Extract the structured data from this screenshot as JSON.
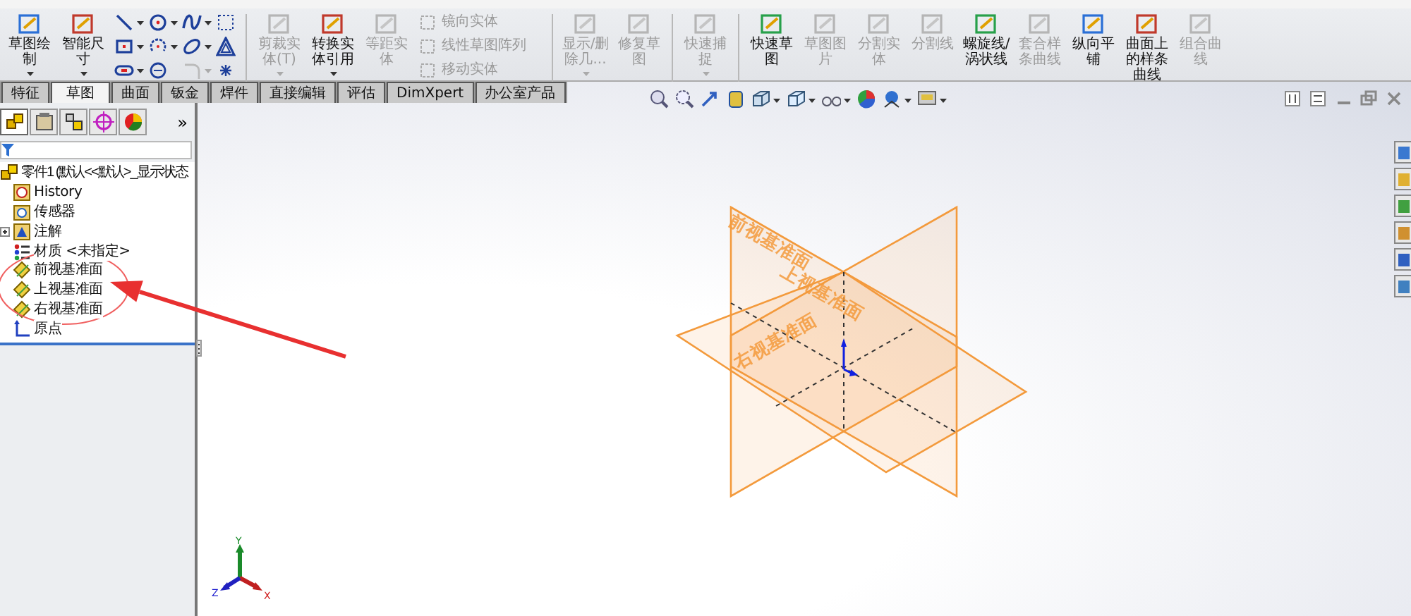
{
  "ribbon": [
    {
      "kind": "button",
      "label": "草图绘制",
      "disabled": false,
      "dropdown": true
    },
    {
      "kind": "button",
      "label": "智能尺寸",
      "disabled": false,
      "dropdown": true
    },
    {
      "kind": "sketch-tools"
    },
    {
      "kind": "separator"
    },
    {
      "kind": "button",
      "label": "剪裁实体(T)",
      "disabled": true,
      "dropdown": true
    },
    {
      "kind": "button",
      "label": "转换实体引用",
      "disabled": false,
      "dropdown": true
    },
    {
      "kind": "button",
      "label": "等距实体",
      "disabled": true,
      "dropdown": false
    },
    {
      "kind": "list",
      "items": [
        {
          "label": "镜向实体",
          "disabled": true
        },
        {
          "label": "线性草图阵列",
          "disabled": true
        },
        {
          "label": "移动实体",
          "disabled": true
        }
      ]
    },
    {
      "kind": "separator"
    },
    {
      "kind": "button",
      "label": "显示/删除几...",
      "disabled": true,
      "dropdown": true
    },
    {
      "kind": "button",
      "label": "修复草图",
      "disabled": true,
      "dropdown": false
    },
    {
      "kind": "separator"
    },
    {
      "kind": "button",
      "label": "快速捕捉",
      "disabled": true,
      "dropdown": true
    },
    {
      "kind": "separator"
    },
    {
      "kind": "button",
      "label": "快速草图",
      "disabled": false,
      "dropdown": false
    },
    {
      "kind": "button",
      "label": "草图图片",
      "disabled": true,
      "dropdown": false
    },
    {
      "kind": "button",
      "label": "分割实体",
      "disabled": true,
      "dropdown": false
    },
    {
      "kind": "button",
      "label": "分割线",
      "disabled": true,
      "dropdown": false
    },
    {
      "kind": "button",
      "label": "螺旋线/涡状线",
      "disabled": false,
      "dropdown": false
    },
    {
      "kind": "button",
      "label": "套合样条曲线",
      "disabled": true,
      "dropdown": false
    },
    {
      "kind": "button",
      "label": "纵向平铺",
      "disabled": false,
      "dropdown": false
    },
    {
      "kind": "button",
      "label": "曲面上的样条曲线",
      "disabled": false,
      "dropdown": false
    },
    {
      "kind": "button",
      "label": "组合曲线",
      "disabled": true,
      "dropdown": false
    }
  ],
  "tabs": [
    {
      "label": "特征",
      "selected": false
    },
    {
      "label": "草图",
      "selected": true
    },
    {
      "label": "曲面",
      "selected": false
    },
    {
      "label": "钣金",
      "selected": false
    },
    {
      "label": "焊件",
      "selected": false
    },
    {
      "label": "直接编辑",
      "selected": false
    },
    {
      "label": "评估",
      "selected": false
    },
    {
      "label": "DimXpert",
      "selected": false
    },
    {
      "label": "办公室产品",
      "selected": false
    }
  ],
  "panel_tabs": [
    {
      "selected": true
    },
    {
      "selected": false
    },
    {
      "selected": false
    },
    {
      "selected": false
    },
    {
      "selected": false
    }
  ],
  "panel_more": "»",
  "tree": {
    "label": "零件1  (默认<<默认>_显示状态",
    "kind": "part",
    "children": [
      {
        "label": "History",
        "kind": "history"
      },
      {
        "label": "传感器",
        "kind": "sensor"
      },
      {
        "label": "注解",
        "kind": "annotation",
        "expanded": false
      },
      {
        "label": "材质 <未指定>",
        "kind": "material"
      },
      {
        "label": "前视基准面",
        "kind": "plane"
      },
      {
        "label": "上视基准面",
        "kind": "plane"
      },
      {
        "label": "右视基准面",
        "kind": "plane"
      },
      {
        "label": "原点",
        "kind": "origin"
      }
    ]
  },
  "planes": [
    {
      "kind": "front",
      "label": "前视基准面"
    },
    {
      "kind": "top",
      "label": "上视基准面"
    },
    {
      "kind": "right",
      "label": "右视基准面"
    }
  ],
  "triad": {
    "x": "X",
    "y": "Y",
    "z": "Z"
  }
}
